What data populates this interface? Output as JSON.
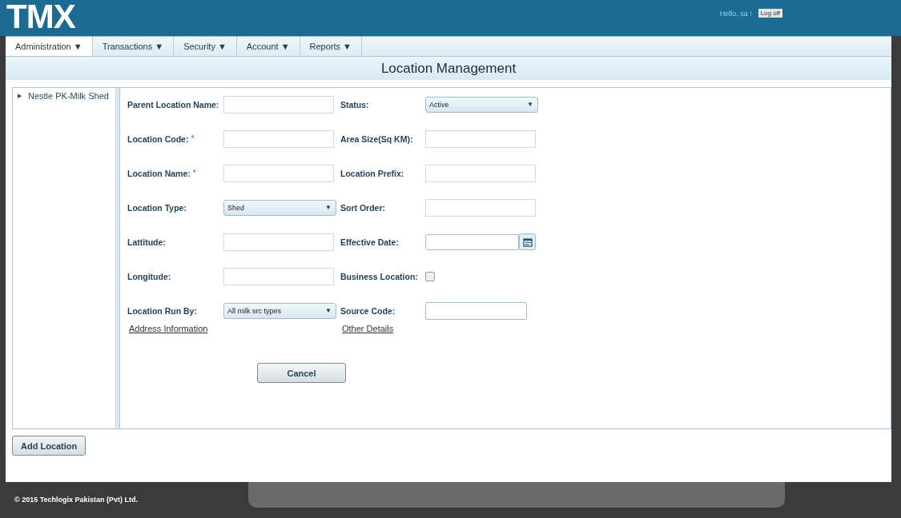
{
  "header": {
    "logo": "TMX",
    "greeting": "Hello, sa !",
    "logoff": "Log off"
  },
  "menu": [
    {
      "label": "Administration",
      "caret": "▼",
      "selected": true
    },
    {
      "label": "Transactions",
      "caret": "▼",
      "selected": false
    },
    {
      "label": "Security",
      "caret": "▼",
      "selected": false
    },
    {
      "label": "Account",
      "caret": "▼",
      "selected": false
    },
    {
      "label": "Reports",
      "caret": "▼",
      "selected": false
    }
  ],
  "page_title": "Location Management",
  "tree": [
    {
      "label": "Nestle PK-Milk Shed",
      "arrow": "▶",
      "expanded": false
    }
  ],
  "form": {
    "rows": [
      [
        {
          "label": "Parent Location Name:",
          "kind": "text"
        },
        {
          "label": "Status:",
          "kind": "select",
          "value": "Active",
          "caret": "▼"
        }
      ],
      [
        {
          "label": "Location Code:",
          "kind": "text",
          "required_mark": "*"
        },
        {
          "label": "Area Size(Sq KM):",
          "kind": "text"
        }
      ],
      [
        {
          "label": "Location Name:",
          "kind": "text",
          "required_mark": "*"
        },
        {
          "label": "Location Prefix:",
          "kind": "text"
        }
      ],
      [
        {
          "label": "Location Type:",
          "kind": "select",
          "value": "Shed",
          "caret": "▼"
        },
        {
          "label": "Sort Order:",
          "kind": "text"
        }
      ],
      [
        {
          "label": "Lattitude:",
          "kind": "text"
        },
        {
          "label": "Effective Date:",
          "kind": "date"
        }
      ],
      [
        {
          "label": "Longitude:",
          "kind": "text"
        },
        {
          "label": "Business Location:",
          "kind": "checkbox",
          "checked": false
        }
      ],
      [
        {
          "label": "Location Run By:",
          "kind": "select",
          "value": "All milk src types",
          "caret": "▼"
        },
        {
          "label": "Source Code:",
          "kind": "source"
        }
      ]
    ],
    "links": [
      "Address Information",
      "Other Details"
    ],
    "cancel": "Cancel"
  },
  "add_button": "Add Location",
  "footer": "© 2015 Techlogix Pakistan (Pvt) Ltd."
}
